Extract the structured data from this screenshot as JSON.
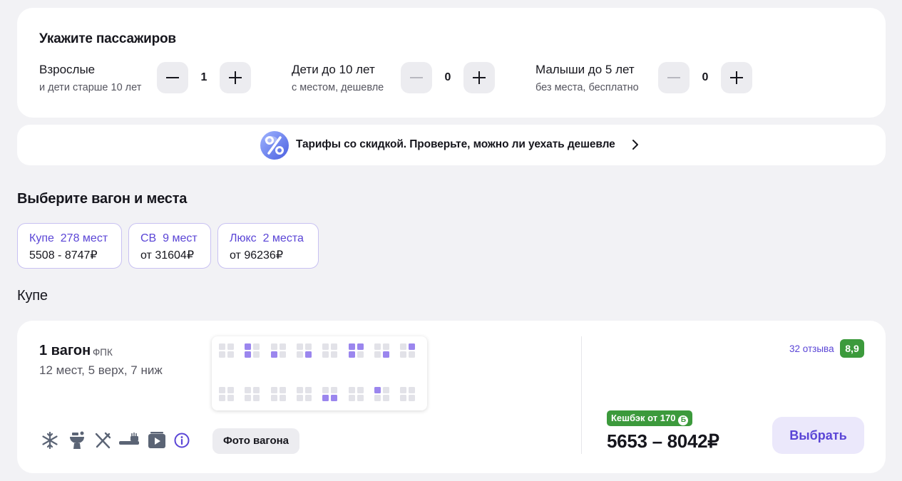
{
  "passengers": {
    "title": "Укажите пассажиров",
    "groups": [
      {
        "label": "Взрослые",
        "sub": "и дети старше 10 лет",
        "count": "1"
      },
      {
        "label": "Дети до 10 лет",
        "sub": "с местом, дешевле",
        "count": "0"
      },
      {
        "label": "Малыши до 5 лет",
        "sub": "без места, бесплатно",
        "count": "0"
      }
    ]
  },
  "discount": {
    "text": "Тарифы со скидкой. Проверьте, можно ли уехать дешевле"
  },
  "choose": {
    "title": "Выберите вагон и места",
    "classes": [
      {
        "name": "Купе",
        "seats": "278 мест",
        "price": "5508 - 8747₽"
      },
      {
        "name": "СВ",
        "seats": "9 мест",
        "price": "от 31604₽"
      },
      {
        "name": "Люкс",
        "seats": "2 места",
        "price": "от 96236₽"
      }
    ]
  },
  "section": {
    "title": "Купе"
  },
  "wagon": {
    "number": "1 вагон",
    "carrier": "ФПК",
    "seats": "12 мест, 5 верх, 7 ниж",
    "photo_label": "Фото вагона",
    "reviews": "32 отзыва",
    "rating": "8,9",
    "cashback": "Кешбэк от 170",
    "cashback_coin": "Б",
    "price": "5653 – 8042₽",
    "select_label": "Выбрать",
    "amenities": [
      "snowflake-icon",
      "wc-icon",
      "food-icon",
      "hygiene-icon",
      "video-icon",
      "info-icon"
    ],
    "compartments_top": [
      [
        0,
        0,
        0,
        0
      ],
      [
        1,
        0,
        1,
        0
      ],
      [
        0,
        0,
        1,
        0
      ],
      [
        0,
        0,
        0,
        1
      ],
      [
        0,
        0,
        0,
        0
      ],
      [
        1,
        1,
        1,
        0
      ],
      [
        0,
        0,
        0,
        1
      ],
      [
        0,
        1,
        0,
        0
      ]
    ],
    "compartments_bottom": [
      [
        0,
        0,
        0,
        0
      ],
      [
        0,
        0,
        0,
        0
      ],
      [
        0,
        0,
        0,
        0
      ],
      [
        0,
        0,
        0,
        0
      ],
      [
        0,
        0,
        1,
        1
      ],
      [
        0,
        0,
        0,
        0
      ],
      [
        1,
        0,
        0,
        0
      ],
      [
        0,
        0,
        0,
        0
      ]
    ]
  },
  "colors": {
    "accent": "#5a45d6",
    "seat_free": "#9b86ee",
    "seat_taken": "#e2e2e8",
    "rating_bg": "#3c9a3c"
  }
}
